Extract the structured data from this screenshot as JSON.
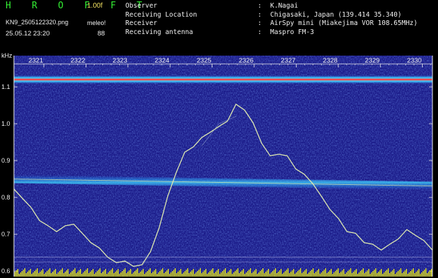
{
  "header": {
    "app_title": "H R O F F T",
    "version": "1.00f",
    "filename": "KN9_2505122320.png",
    "timestamp": "25.05.12 23:20",
    "meleo_label": "meleo!",
    "meleo_value": "88",
    "meta": [
      {
        "key": "Observer",
        "value": "K.Nagai"
      },
      {
        "key": "Receiving Location",
        "value": "Chigasaki, Japan (139.414 35.340)"
      },
      {
        "key": "Receiver",
        "value": "AirSpy mini (Miakejima VOR 108.65MHz)"
      },
      {
        "key": "Receiving antenna",
        "value": "Maspro FM-3"
      }
    ],
    "separator": ":"
  },
  "chart_data": {
    "type": "heatmap",
    "ylabel": "kHz",
    "x_ticks": [
      "2321",
      "2322",
      "2323",
      "2324",
      "2325",
      "2326",
      "2327",
      "2328",
      "2329",
      "2330"
    ],
    "y_ticks": [
      "1.1",
      "1.0",
      "0.9",
      "0.8",
      "0.7",
      "0.6"
    ],
    "ylim": [
      0.585,
      1.185
    ],
    "horizontal_bands_khz": [
      1.12,
      0.85
    ],
    "doppler_trace_khz": [
      0.82,
      0.8,
      0.77,
      0.74,
      0.72,
      0.71,
      0.72,
      0.73,
      0.7,
      0.68,
      0.66,
      0.64,
      0.62,
      0.63,
      0.61,
      0.62,
      0.65,
      0.72,
      0.8,
      0.87,
      0.92,
      0.94,
      0.96,
      0.98,
      0.99,
      1.01,
      1.05,
      1.04,
      1.0,
      0.95,
      0.91,
      0.92,
      0.91,
      0.88,
      0.86,
      0.84,
      0.8,
      0.77,
      0.74,
      0.71,
      0.7,
      0.68,
      0.67,
      0.66,
      0.67,
      0.69,
      0.71,
      0.7,
      0.68,
      0.66
    ],
    "colors": {
      "background": "#1c1c8a",
      "band_top": "#ff4040",
      "trace": "#dde8b0",
      "axis": "#f0f0f0",
      "bottom_strip": "#ffff00"
    }
  }
}
